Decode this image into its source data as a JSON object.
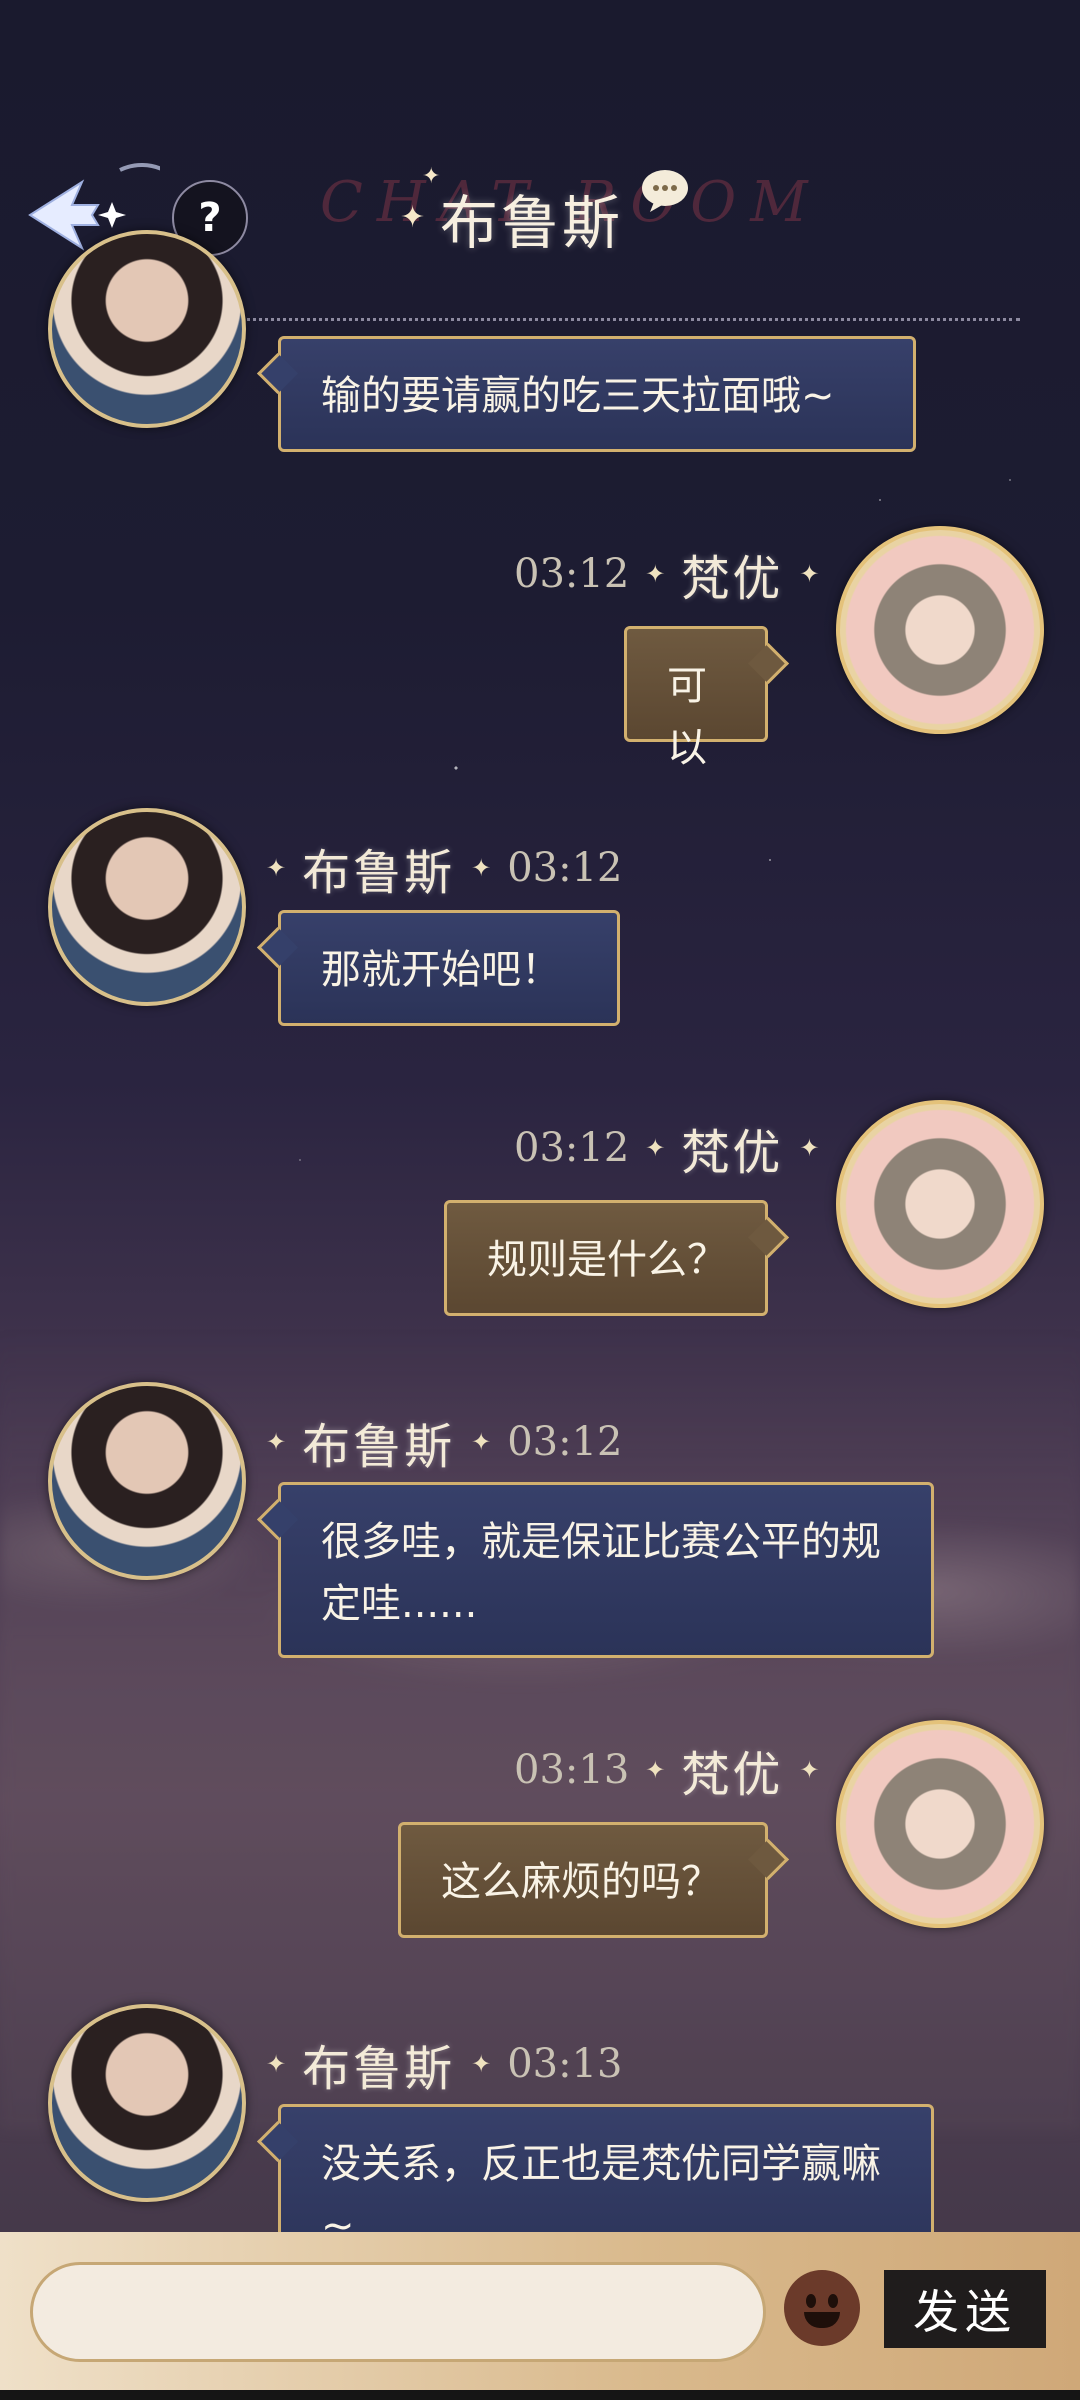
{
  "header": {
    "title": "布鲁斯",
    "watermark": "CHAT ROOM",
    "help_label": "?"
  },
  "messages": [
    {
      "sender": "布鲁斯",
      "time": "",
      "text": "输的要请赢的吃三天拉面哦~",
      "side": "left"
    },
    {
      "sender": "梵优",
      "time": "03:12",
      "text": "可以",
      "side": "right"
    },
    {
      "sender": "布鲁斯",
      "time": "03:12",
      "text": "那就开始吧！",
      "side": "left"
    },
    {
      "sender": "梵优",
      "time": "03:12",
      "text": "规则是什么？",
      "side": "right"
    },
    {
      "sender": "布鲁斯",
      "time": "03:12",
      "text": "很多哇，就是保证比赛公平的规定哇......",
      "side": "left"
    },
    {
      "sender": "梵优",
      "time": "03:13",
      "text": "这么麻烦的吗？",
      "side": "right"
    },
    {
      "sender": "布鲁斯",
      "time": "03:13",
      "text": "没关系，反正也是梵优同学赢嘛~",
      "side": "left"
    }
  ],
  "input": {
    "placeholder": "",
    "send_label": "发送"
  },
  "icons": {
    "back": "back-arrow-icon",
    "help": "question-icon",
    "emoji": "emoji-icon",
    "bubble": "chat-bubble-icon"
  }
}
